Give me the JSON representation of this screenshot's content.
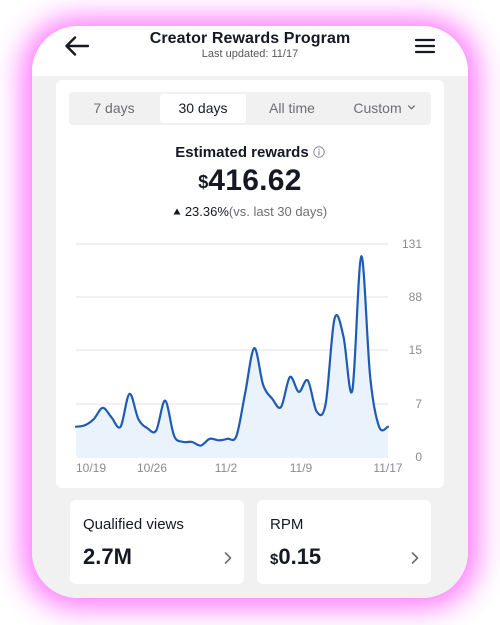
{
  "header": {
    "title": "Creator Rewards Program",
    "subtitle": "Last updated: 11/17"
  },
  "range_tabs": [
    {
      "label": "7 days",
      "active": false
    },
    {
      "label": "30 days",
      "active": true
    },
    {
      "label": "All time",
      "active": false
    },
    {
      "label": "Custom",
      "active": false
    }
  ],
  "summary": {
    "label": "Estimated rewards",
    "currency": "$",
    "amount": "416.62",
    "change": "23.36%",
    "comparison": "(vs. last 30 days)"
  },
  "chart_data": {
    "type": "area",
    "x_tick_labels": [
      "10/19",
      "10/26",
      "11/2",
      "11/9",
      "11/17"
    ],
    "y_tick_labels": [
      "131",
      "88",
      "15",
      "7",
      "0"
    ],
    "grid": true,
    "y_axis_position": "right",
    "series": [
      {
        "values": [
          4.0,
          4.2,
          5.0,
          6.5,
          5.2,
          4.0,
          8.5,
          5.0,
          3.8,
          3.5,
          7.5,
          2.8,
          2.0,
          2.0,
          1.5,
          2.4,
          2.2,
          2.4,
          2.8,
          8.8,
          17.5,
          9.8,
          7.8,
          6.6,
          11.0,
          8.8,
          10.5,
          6.0,
          7.0,
          58.0,
          34.0,
          9.0,
          121.0,
          11.0,
          4.0,
          4.0
        ],
        "color": "#1f5bb5",
        "fill": "#eaf2fb"
      }
    ]
  },
  "stats": [
    {
      "label": "Qualified views",
      "value": "2.7M",
      "currency": ""
    },
    {
      "label": "RPM",
      "value": "0.15",
      "currency": "$"
    }
  ],
  "colors": {
    "glow": "#ff4dff",
    "line": "#1f5bb5",
    "page_bg": "#f1f1f2"
  },
  "icons": {
    "back": "arrow-left-icon",
    "menu": "hamburger-menu-icon",
    "info": "info-circle-icon",
    "up": "triangle-up-icon",
    "chevron": "chevron-right-icon"
  }
}
